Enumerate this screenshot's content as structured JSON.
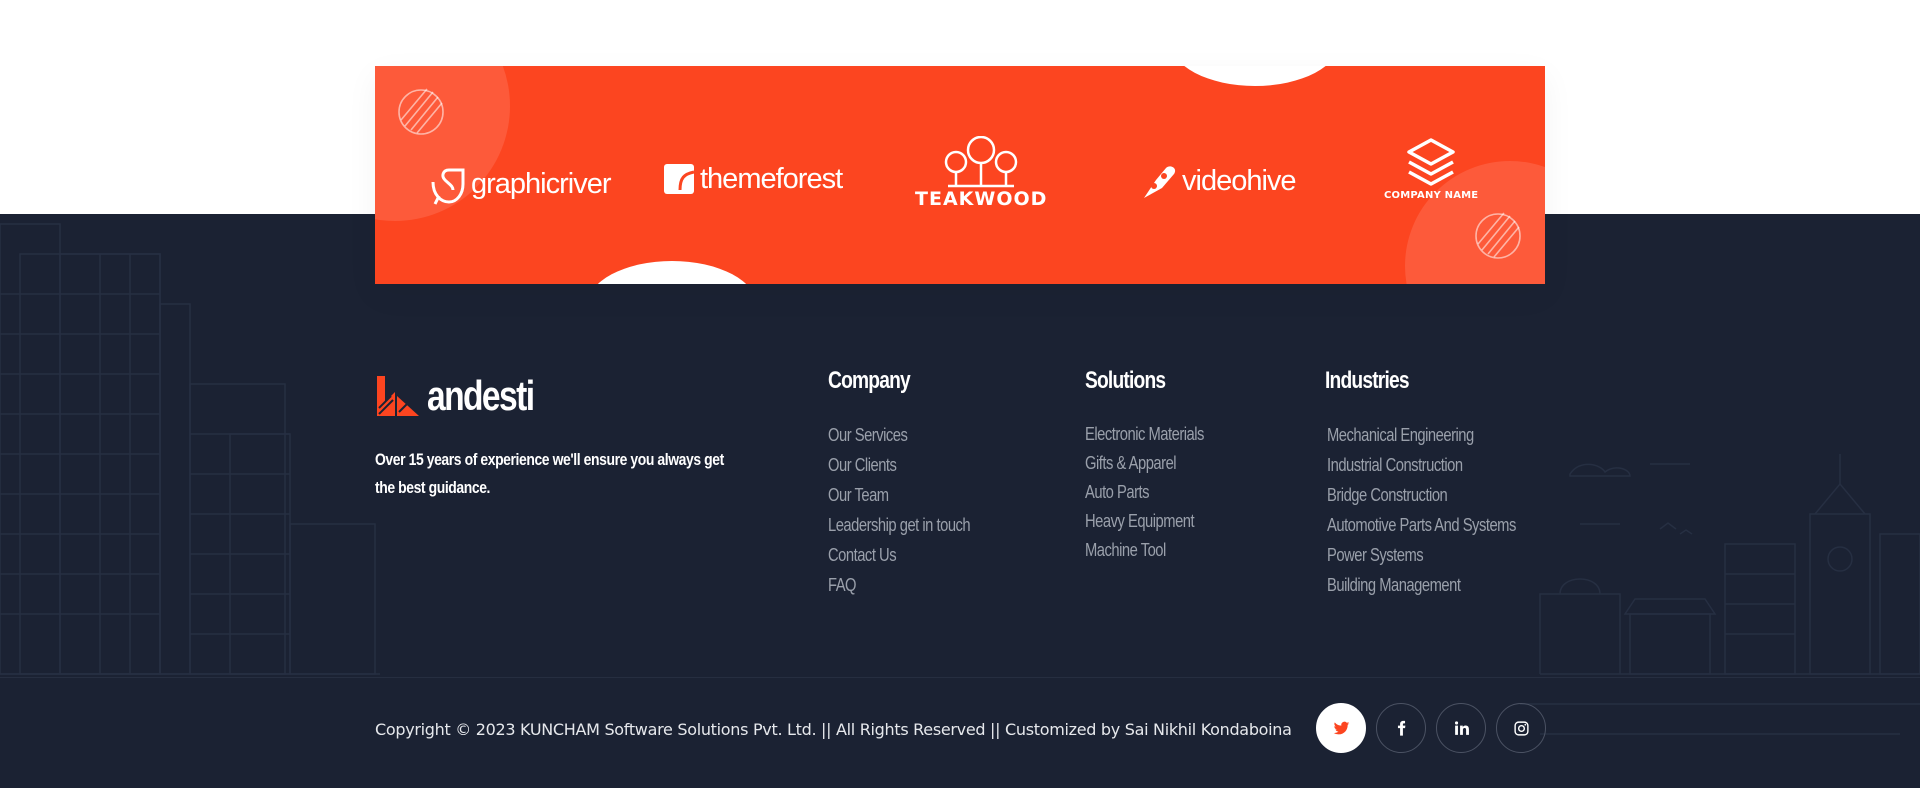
{
  "brands": {
    "graphicriver": "graphicriver",
    "themeforest": "themeforest",
    "teakwood": "TEAKWOOD",
    "videohive": "videohive",
    "company_name": "COMPANY NAME"
  },
  "site": {
    "name": "andesti",
    "tagline": "Over 15 years of experience we'll ensure you always get the best guidance."
  },
  "columns": {
    "company": {
      "title": "Company",
      "items": [
        "Our Services",
        "Our Clients",
        "Our Team",
        "Leadership get in touch",
        "Contact Us",
        "FAQ"
      ]
    },
    "solutions": {
      "title": "Solutions",
      "items": [
        "Electronic Materials",
        "Gifts & Apparel",
        "Auto Parts",
        "Heavy Equipment",
        "Machine Tool"
      ]
    },
    "industries": {
      "title": "Industries",
      "items": [
        "Mechanical Engineering",
        "Industrial Construction",
        "Bridge Construction",
        "Automotive Parts And Systems",
        "Power Systems",
        "Building Management"
      ]
    }
  },
  "copyright": "Copyright © 2023 KUNCHAM Software Solutions Pvt. Ltd. || All Rights Reserved || Customized by Sai Nikhil Kondaboina",
  "socials": [
    {
      "icon": "twitter-icon",
      "active": true
    },
    {
      "icon": "facebook-icon",
      "active": false
    },
    {
      "icon": "linkedin-icon",
      "active": false
    },
    {
      "icon": "instagram-icon",
      "active": false
    }
  ],
  "colors": {
    "accent": "#fc4520",
    "footer_bg": "#1b2233",
    "link": "#9aa0ab",
    "white": "#ffffff"
  }
}
